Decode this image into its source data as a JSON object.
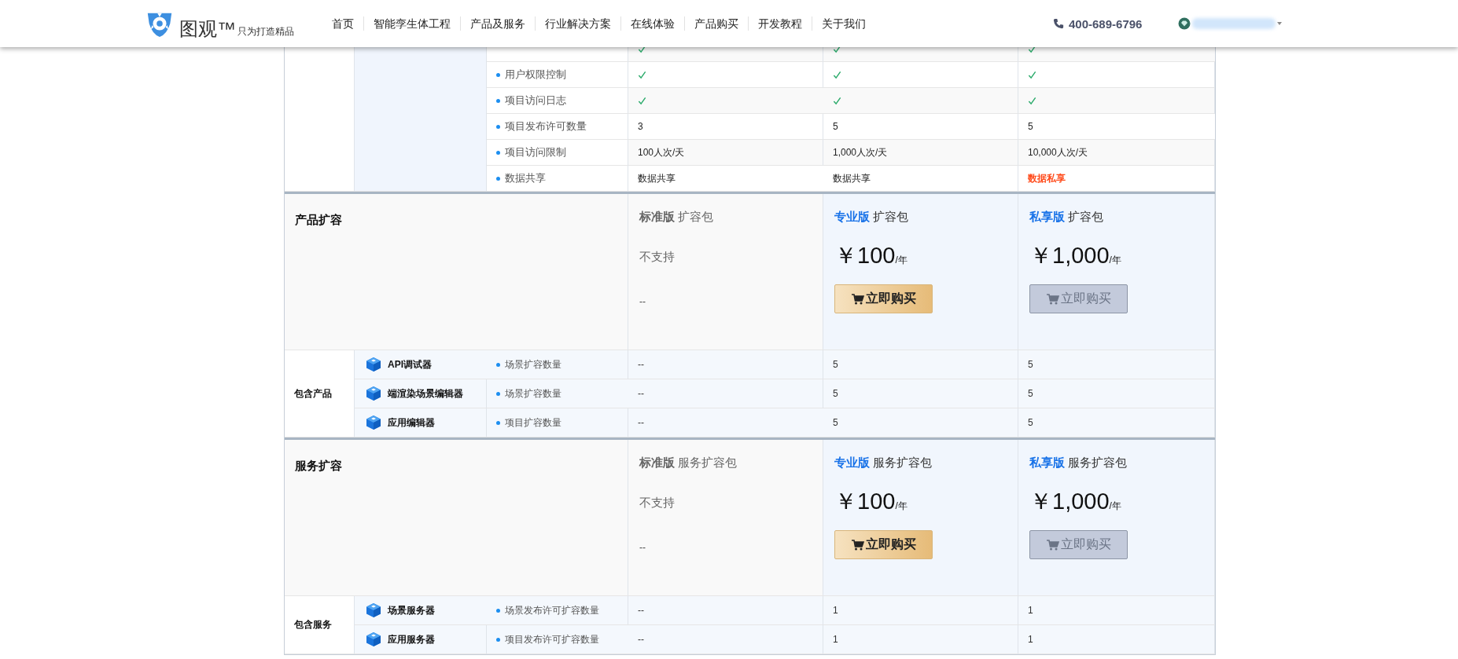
{
  "header": {
    "logo_text": "图观™",
    "slogan": "只为打造精品",
    "nav": [
      {
        "label": "首页"
      },
      {
        "label": "智能孪生体工程"
      },
      {
        "label": "产品及服务"
      },
      {
        "label": "行业解决方案"
      },
      {
        "label": "在线体验"
      },
      {
        "label": "产品购买"
      },
      {
        "label": "开发教程"
      },
      {
        "label": "关于我们"
      }
    ],
    "phone": "400-689-6796"
  },
  "feature_rows": [
    {
      "values": [
        {
          "kind": "check"
        },
        {
          "kind": "check"
        },
        {
          "kind": "check"
        }
      ]
    },
    {
      "label": "用户权限控制",
      "values": [
        {
          "kind": "check"
        },
        {
          "kind": "check"
        },
        {
          "kind": "check"
        }
      ]
    },
    {
      "label": "项目访问日志",
      "values": [
        {
          "kind": "check"
        },
        {
          "kind": "check"
        },
        {
          "kind": "check"
        }
      ]
    },
    {
      "label": "项目发布许可数量",
      "values": [
        {
          "kind": "text",
          "text": "3"
        },
        {
          "kind": "text",
          "text": "5"
        },
        {
          "kind": "text",
          "text": "5"
        }
      ]
    },
    {
      "label": "项目访问限制",
      "values": [
        {
          "kind": "text",
          "text": "100人次/天"
        },
        {
          "kind": "text",
          "text": "1,000人次/天"
        },
        {
          "kind": "text",
          "text": "10,000人次/天"
        }
      ]
    },
    {
      "label": "数据共享",
      "values": [
        {
          "kind": "text",
          "text": "数据共享"
        },
        {
          "kind": "text",
          "text": "数据共享"
        },
        {
          "kind": "alert",
          "text": "数据私享"
        }
      ]
    }
  ],
  "sections": [
    {
      "title": "产品扩容",
      "group_label": "包含产品",
      "plans": [
        {
          "kind": "unsupported",
          "name": "标准版",
          "suffix": "扩容包",
          "note": "不支持",
          "price_placeholder": "--"
        },
        {
          "kind": "paid",
          "name": "专业版",
          "suffix": "扩容包",
          "price": "￥100",
          "unit": "/年",
          "button": {
            "label": "立即购买",
            "disabled": false
          }
        },
        {
          "kind": "paid",
          "name": "私享版",
          "suffix": "扩容包",
          "price": "￥1,000",
          "unit": "/年",
          "button": {
            "label": "立即购买",
            "disabled": true
          }
        }
      ],
      "items": [
        {
          "name": "API调试器",
          "metric": "场景扩容数量",
          "values": [
            "--",
            "5",
            "5"
          ]
        },
        {
          "name": "端渲染场景编辑器",
          "metric": "场景扩容数量",
          "values": [
            "--",
            "5",
            "5"
          ]
        },
        {
          "name": "应用编辑器",
          "metric": "项目扩容数量",
          "values": [
            "--",
            "5",
            "5"
          ]
        }
      ]
    },
    {
      "title": "服务扩容",
      "group_label": "包含服务",
      "plans": [
        {
          "kind": "unsupported",
          "name": "标准版",
          "suffix": "服务扩容包",
          "note": "不支持",
          "price_placeholder": "--"
        },
        {
          "kind": "paid",
          "name": "专业版",
          "suffix": "服务扩容包",
          "price": "￥100",
          "unit": "/年",
          "button": {
            "label": "立即购买",
            "disabled": false
          }
        },
        {
          "kind": "paid",
          "name": "私享版",
          "suffix": "服务扩容包",
          "price": "￥1,000",
          "unit": "/年",
          "button": {
            "label": "立即购买",
            "disabled": true
          }
        }
      ],
      "items": [
        {
          "name": "场景服务器",
          "metric": "场景发布许可扩容数量",
          "values": [
            "--",
            "1",
            "1"
          ]
        },
        {
          "name": "应用服务器",
          "metric": "项目发布许可扩容数量",
          "values": [
            "--",
            "1",
            "1"
          ]
        }
      ]
    }
  ]
}
